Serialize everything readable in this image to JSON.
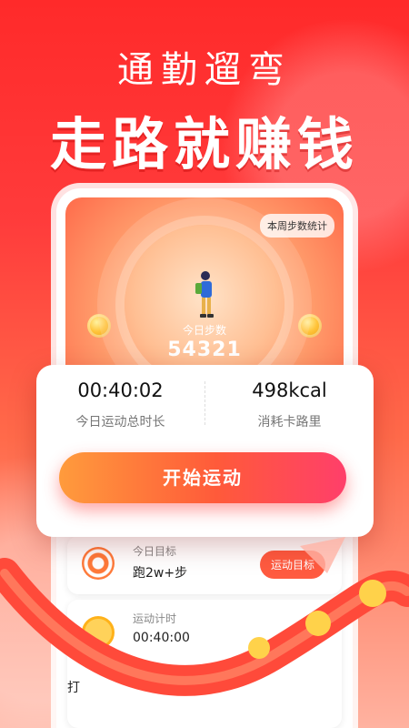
{
  "header": {
    "subtitle": "通勤遛弯",
    "title": "走路就赚钱"
  },
  "hero": {
    "week_stats_label": "本周步数统计",
    "today_steps_label": "今日步数",
    "today_steps_value": "54321"
  },
  "stats": {
    "duration_value": "00:40:02",
    "duration_label": "今日运动总时长",
    "calories_value": "498kcal",
    "calories_label": "消耗卡路里",
    "start_button": "开始运动"
  },
  "target": {
    "title": "今日目标",
    "value": "跑2w+步",
    "button": "运动目标"
  },
  "timer": {
    "title": "运动计时",
    "value": "00:40:00"
  },
  "checkin": {
    "label": "打"
  },
  "colors": {
    "brand_red": "#ff3b3b",
    "button_orange": "#ff9b3c",
    "button_pink": "#ff3f6a"
  }
}
